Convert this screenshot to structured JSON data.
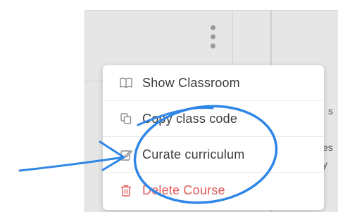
{
  "menu": {
    "items": [
      {
        "label": "Show Classroom",
        "icon": "book-icon"
      },
      {
        "label": "Copy class code",
        "icon": "copy-icon"
      },
      {
        "label": "Curate curriculum",
        "icon": "edit-icon"
      },
      {
        "label": "Delete Course",
        "icon": "trash-icon"
      }
    ]
  },
  "background": {
    "partial_text_1": "s",
    "partial_text_2": "es",
    "partial_text_3": "y"
  },
  "colors": {
    "annotation": "#2f86e6",
    "danger": "#e35a5a",
    "menu_text": "#3b3b3b",
    "icon": "#8a8a8a"
  }
}
